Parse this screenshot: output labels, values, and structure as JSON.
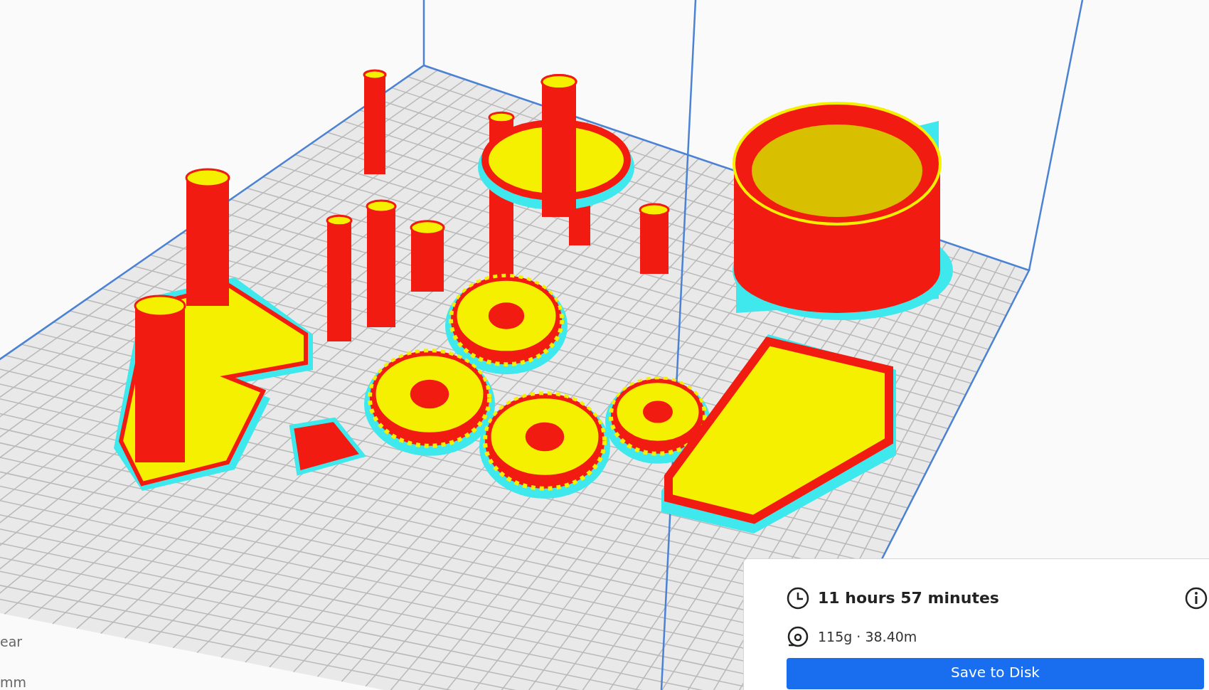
{
  "viewport": {
    "side_labels": [
      "ear",
      "mm"
    ]
  },
  "print_summary": {
    "time": "11 hours 57 minutes",
    "material": "115g · 38.40m",
    "action_button": "Save to Disk"
  }
}
